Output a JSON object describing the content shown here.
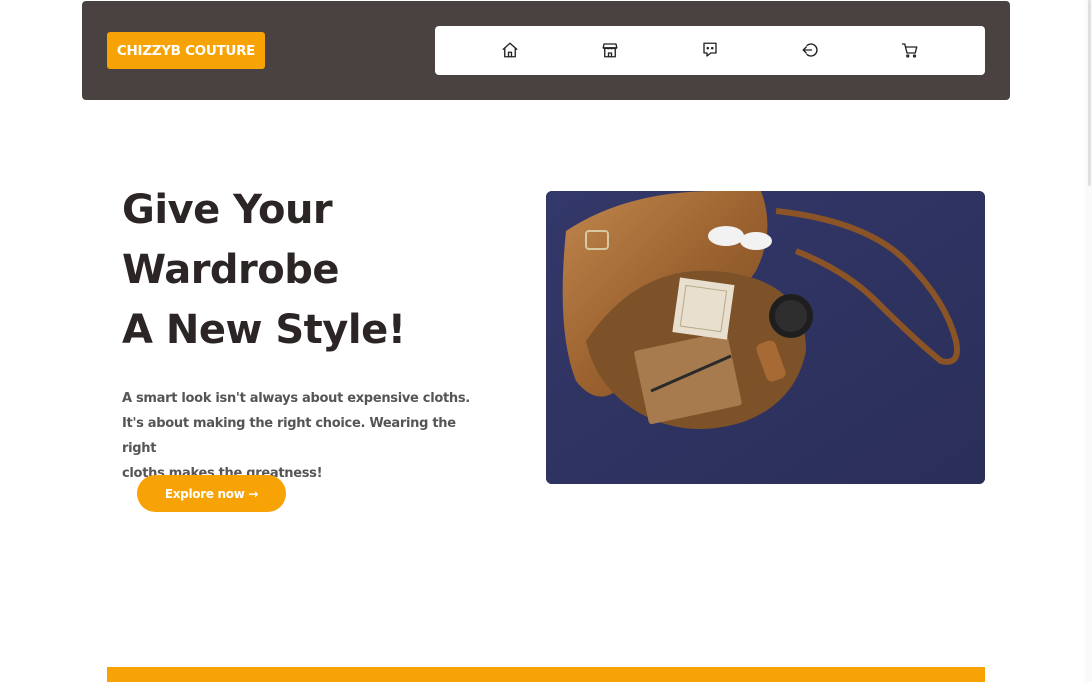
{
  "brand": {
    "logo_text": "CHIZZYB COUTURE"
  },
  "nav": {
    "items": [
      {
        "icon": "home-icon",
        "label": "Home"
      },
      {
        "icon": "store-icon",
        "label": "Shop"
      },
      {
        "icon": "chat-icon",
        "label": "Contact"
      },
      {
        "icon": "login-icon",
        "label": "Login"
      },
      {
        "icon": "cart-icon",
        "label": "Cart"
      }
    ]
  },
  "hero": {
    "title_line1": "Give Your",
    "title_line2": "Wardrobe",
    "title_line3": "A New Style!",
    "text_line1": "A smart look isn't always about expensive cloths.",
    "text_line2": "It's about making the right choice. Wearing the right",
    "text_line3": "cloths makes the greatness!",
    "cta_label": "Explore now →"
  },
  "colors": {
    "accent": "#f7a306",
    "navbar": "#4a4240",
    "image_background": "#303562"
  }
}
